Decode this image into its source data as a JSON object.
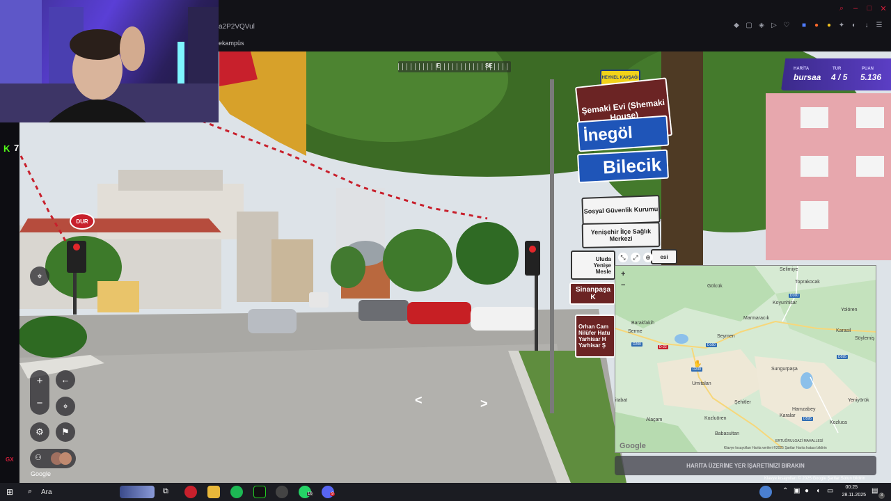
{
  "browser": {
    "url_fragment": "a2P2VQVul",
    "bookmark_label": "ekampüs"
  },
  "stream_overlay": {
    "kick_viewers": "7",
    "gx_label": "GX"
  },
  "compass": {
    "labels": [
      "E",
      "SE"
    ]
  },
  "score_panel": {
    "map_label": "HARİTA",
    "map_value": "bursaa",
    "round_label": "TUR",
    "round_value": "4 / 5",
    "score_label": "PUAN",
    "score_value": "5.136"
  },
  "street_signs": {
    "top_yellow": "HEYKEL KAVŞAĞI",
    "sign1": "Şemaki Evi (Shemaki House)",
    "sign2": "İnegöl",
    "sign3": "Bilecik",
    "sign4": "Sosyal Güvenlik Kurumu",
    "sign5": "Yenişehir İlçe Sağlık Merkezi",
    "sign6_line1": "Uluda",
    "sign6_line2": "Yenişe",
    "sign6_line3": "Mesle",
    "sign6_tail": "esi",
    "sign7": "Sinanpaşa K",
    "sign8_line1": "Orhan Cam",
    "sign8_line2": "Nilüfer Hatu",
    "sign8_line3": "Yarhisar H",
    "sign8_line4": "Yarhisar Ş",
    "stop_sign": "DUR"
  },
  "map": {
    "place_labels": [
      {
        "text": "Selimiye"
      },
      {
        "text": "Gölcük"
      },
      {
        "text": "Toprakocak"
      },
      {
        "text": "Koyunhisar"
      },
      {
        "text": "Yolören"
      },
      {
        "text": "Barakfakih"
      },
      {
        "text": "Serme"
      },
      {
        "text": "Marmaracık"
      },
      {
        "text": "Karasil"
      },
      {
        "text": "Söylemiş"
      },
      {
        "text": "Seymen"
      },
      {
        "text": "Sungurpaşa"
      },
      {
        "text": "Umitalan"
      },
      {
        "text": "Şehitler"
      },
      {
        "text": "Yeniyörük"
      },
      {
        "text": "Hamzabey"
      },
      {
        "text": "Alaçam"
      },
      {
        "text": "Kozluören"
      },
      {
        "text": "Karalar"
      },
      {
        "text": "Kozluca"
      },
      {
        "text": "Babasultan"
      },
      {
        "text": "ERTUĞRULGAZİ MAHALLESİ"
      },
      {
        "text": "itabat"
      }
    ],
    "road_tags": [
      "D160",
      "D200",
      "D-22",
      "D160",
      "D200",
      "D595",
      "D595"
    ],
    "zoom_in": "+",
    "zoom_out": "−",
    "google_logo": "Google",
    "footer": "Klavye kısayolları   Harita verileri ©2025   Şartlar   Harita hatası bildirin"
  },
  "guess_bar": {
    "label": "HARİTA ÜZERİNE YER İŞARETİNİZİ BIRAKIN"
  },
  "bottom_attribution": "Klavye kısayolları   © 2025 Google   Şartlar   Sorun bildirin",
  "controls": {
    "zoom_in": "+",
    "zoom_out": "−",
    "back": "←",
    "google_label": "Google"
  },
  "taskbar": {
    "search_placeholder": "Ara",
    "time": "00:25",
    "date": "28.11.2025",
    "whatsapp_badge": "16",
    "discord_badge": "9",
    "notification_count": "3"
  }
}
